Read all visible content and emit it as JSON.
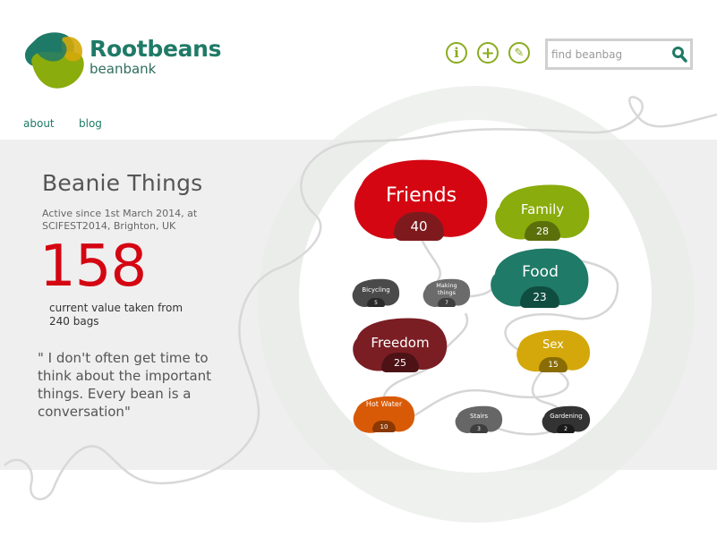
{
  "header": {
    "brand": "Rootbeans",
    "tagline": "beanbank",
    "info_icon": "info-icon",
    "add_icon": "plus-icon",
    "edit_icon": "pencil-icon",
    "search_placeholder": "find beanbag",
    "search_icon": "search-icon"
  },
  "nav": {
    "about": "about",
    "blog": "blog"
  },
  "bank": {
    "title": "Beanie Things",
    "active_since": "Active since 1st March 2014,  at SCIFEST2014, Brighton, UK",
    "value": "158",
    "value_note": "current value taken from 240 bags",
    "quote": "\" I don't often get time to think about the important things. Every bean is a conversation\""
  },
  "beans": {
    "friends": {
      "label": "Friends",
      "count": "40",
      "color": "#d40612"
    },
    "family": {
      "label": "Family",
      "count": "28",
      "color": "#8aac0c"
    },
    "food": {
      "label": "Food",
      "count": "23",
      "color": "#1f7a67"
    },
    "bicycling": {
      "label": "Bicycling",
      "count": "5",
      "color": "#4a4a4a"
    },
    "making": {
      "label": "Making things",
      "count": "7",
      "color": "#6b6b6b"
    },
    "freedom": {
      "label": "Freedom",
      "count": "25",
      "color": "#7a1e24"
    },
    "sex": {
      "label": "Sex",
      "count": "15",
      "color": "#d4a80a"
    },
    "hotwater": {
      "label": "Hot Water",
      "count": "10",
      "color": "#d95a06"
    },
    "stairs": {
      "label": "Stairs",
      "count": "3",
      "color": "#666666"
    },
    "gardening": {
      "label": "Gardening",
      "count": "2",
      "color": "#333333"
    }
  }
}
